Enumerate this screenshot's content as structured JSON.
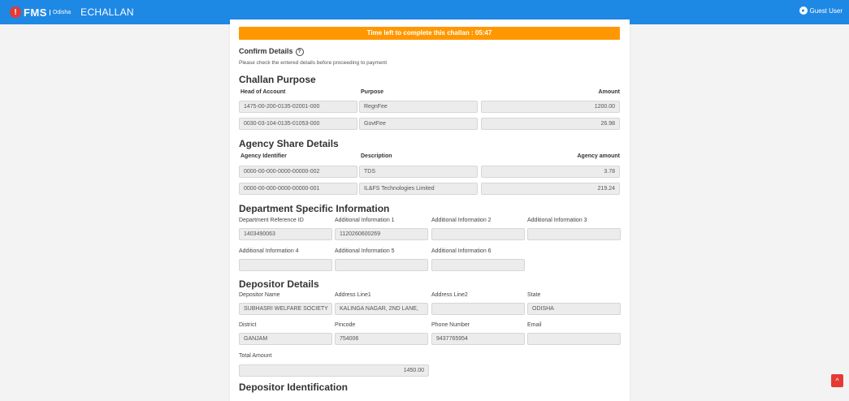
{
  "header": {
    "logo_letter": "!",
    "logo_fms": "FMS",
    "logo_odisha": "Odisha",
    "app_title": "ECHALLAN",
    "user_label": "Guest User"
  },
  "timer_text": "Time left to complete this challan : 05:47",
  "confirm": {
    "title": "Confirm Details",
    "help_glyph": "?",
    "subtitle": "Please check the entered details before proceeding to payment"
  },
  "challan_purpose": {
    "title": "Challan Purpose",
    "headers": [
      "Head of Account",
      "Purpose",
      "Amount"
    ],
    "rows": [
      {
        "account": "1475-00-200-0135-02001-000",
        "purpose": "RegnFee",
        "amount": "1200.00"
      },
      {
        "account": "0030-03-104-0135-01053-000",
        "purpose": "GovtFee",
        "amount": "26.98"
      }
    ]
  },
  "agency_share": {
    "title": "Agency Share Details",
    "headers": [
      "Agency Identifier",
      "Description",
      "Agency amount"
    ],
    "rows": [
      {
        "id": "0000-00-000-0000-00000-002",
        "desc": "TDS",
        "amount": "3.78"
      },
      {
        "id": "0000-00-000-0000-00000-001",
        "desc": "IL&FS Technologies Limited",
        "amount": "219.24"
      }
    ]
  },
  "department": {
    "title": "Department Specific Information",
    "labels": [
      "Department Reference ID",
      "Additional Information 1",
      "Additional Information 2",
      "Additional Information 3",
      "Additional Information 4",
      "Additional Information 5",
      "Additional Information 6"
    ],
    "values": [
      "1403490063",
      "1120260600269",
      "",
      "",
      "",
      "",
      ""
    ]
  },
  "depositor": {
    "title": "Depositor Details",
    "labels": [
      "Depositor Name",
      "Address Line1",
      "Address Line2",
      "State",
      "District",
      "Pincode",
      "Phone Number",
      "Email",
      "Total Amount"
    ],
    "values": [
      "SUBHASRI WELFARE SOCIETY",
      "KALINGA NAGAR, 2ND LANE,",
      "",
      "ODISHA",
      "GANJAM",
      "754006",
      "9437765954",
      "",
      "1450.00"
    ]
  },
  "identification": {
    "title": "Depositor Identification"
  },
  "scroll_top_glyph": "^",
  "colors": {
    "header_blue": "#1e88e5",
    "timer_orange": "#ff9800",
    "scroll_red": "#e53935"
  }
}
